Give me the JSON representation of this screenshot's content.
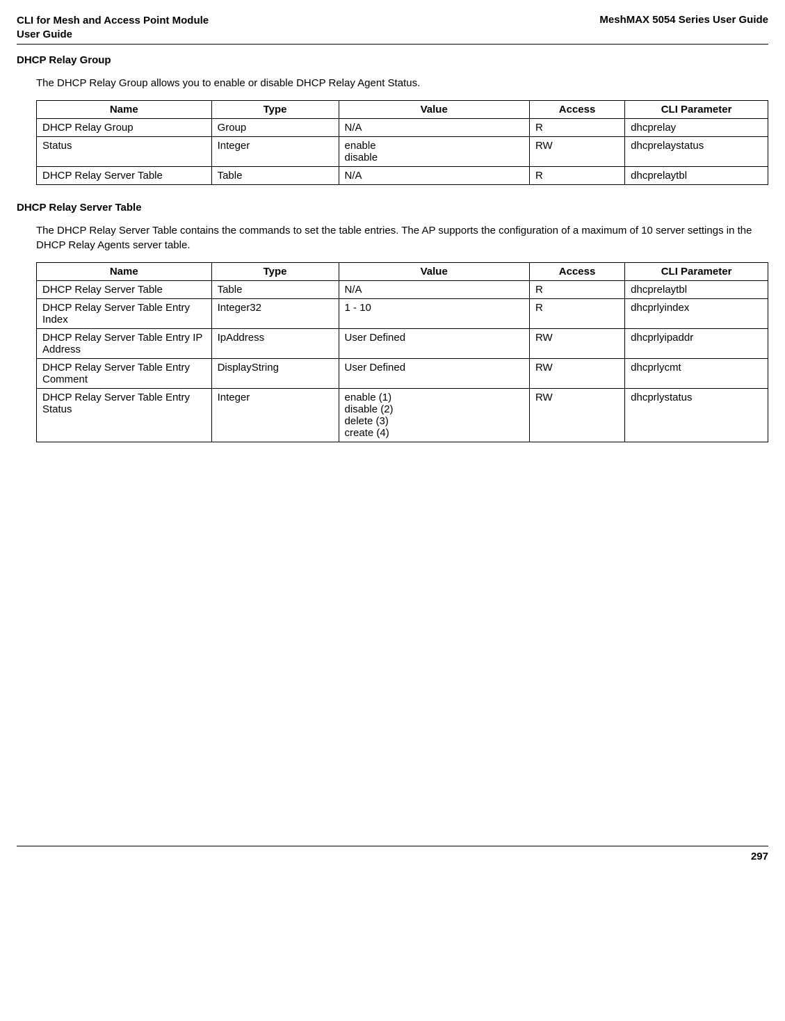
{
  "header": {
    "left_line1": "CLI for Mesh and Access Point Module",
    "left_line2": " User Guide",
    "right": "MeshMAX 5054 Series User Guide"
  },
  "section1": {
    "title": "DHCP Relay Group",
    "description": "The DHCP Relay Group allows you to enable or disable DHCP Relay Agent Status.",
    "table": {
      "headers": [
        "Name",
        "Type",
        "Value",
        "Access",
        "CLI Parameter"
      ],
      "rows": [
        {
          "name": "DHCP Relay Group",
          "type": "Group",
          "value": "N/A",
          "access": "R",
          "cli": "dhcprelay"
        },
        {
          "name": "Status",
          "type": "Integer",
          "value": "enable\ndisable",
          "access": "RW",
          "cli": "dhcprelaystatus"
        },
        {
          "name": "DHCP Relay Server Table",
          "type": "Table",
          "value": "N/A",
          "access": "R",
          "cli": "dhcprelaytbl"
        }
      ]
    }
  },
  "section2": {
    "title": "DHCP Relay Server Table",
    "description": "The DHCP Relay Server Table contains the commands to set the table entries. The AP supports the configuration of a maximum of 10 server settings in the DHCP Relay Agents server table.",
    "table": {
      "headers": [
        "Name",
        "Type",
        "Value",
        "Access",
        "CLI Parameter"
      ],
      "rows": [
        {
          "name": "DHCP Relay Server Table",
          "type": "Table",
          "value": "N/A",
          "access": "R",
          "cli": "dhcprelaytbl"
        },
        {
          "name": "DHCP Relay Server Table Entry Index",
          "type": "Integer32",
          "value": "1 - 10",
          "access": "R",
          "cli": "dhcprlyindex"
        },
        {
          "name": "DHCP Relay Server Table Entry IP Address",
          "type": "IpAddress",
          "value": "User Defined",
          "access": "RW",
          "cli": "dhcprlyipaddr"
        },
        {
          "name": "DHCP Relay Server Table Entry Comment",
          "type": "DisplayString",
          "value": "User Defined",
          "access": "RW",
          "cli": "dhcprlycmt"
        },
        {
          "name": "DHCP Relay Server Table Entry Status",
          "type": "Integer",
          "value": "enable (1)\ndisable (2)\ndelete (3)\ncreate (4)",
          "access": "RW",
          "cli": "dhcprlystatus"
        }
      ]
    }
  },
  "footer": {
    "page": "297"
  }
}
